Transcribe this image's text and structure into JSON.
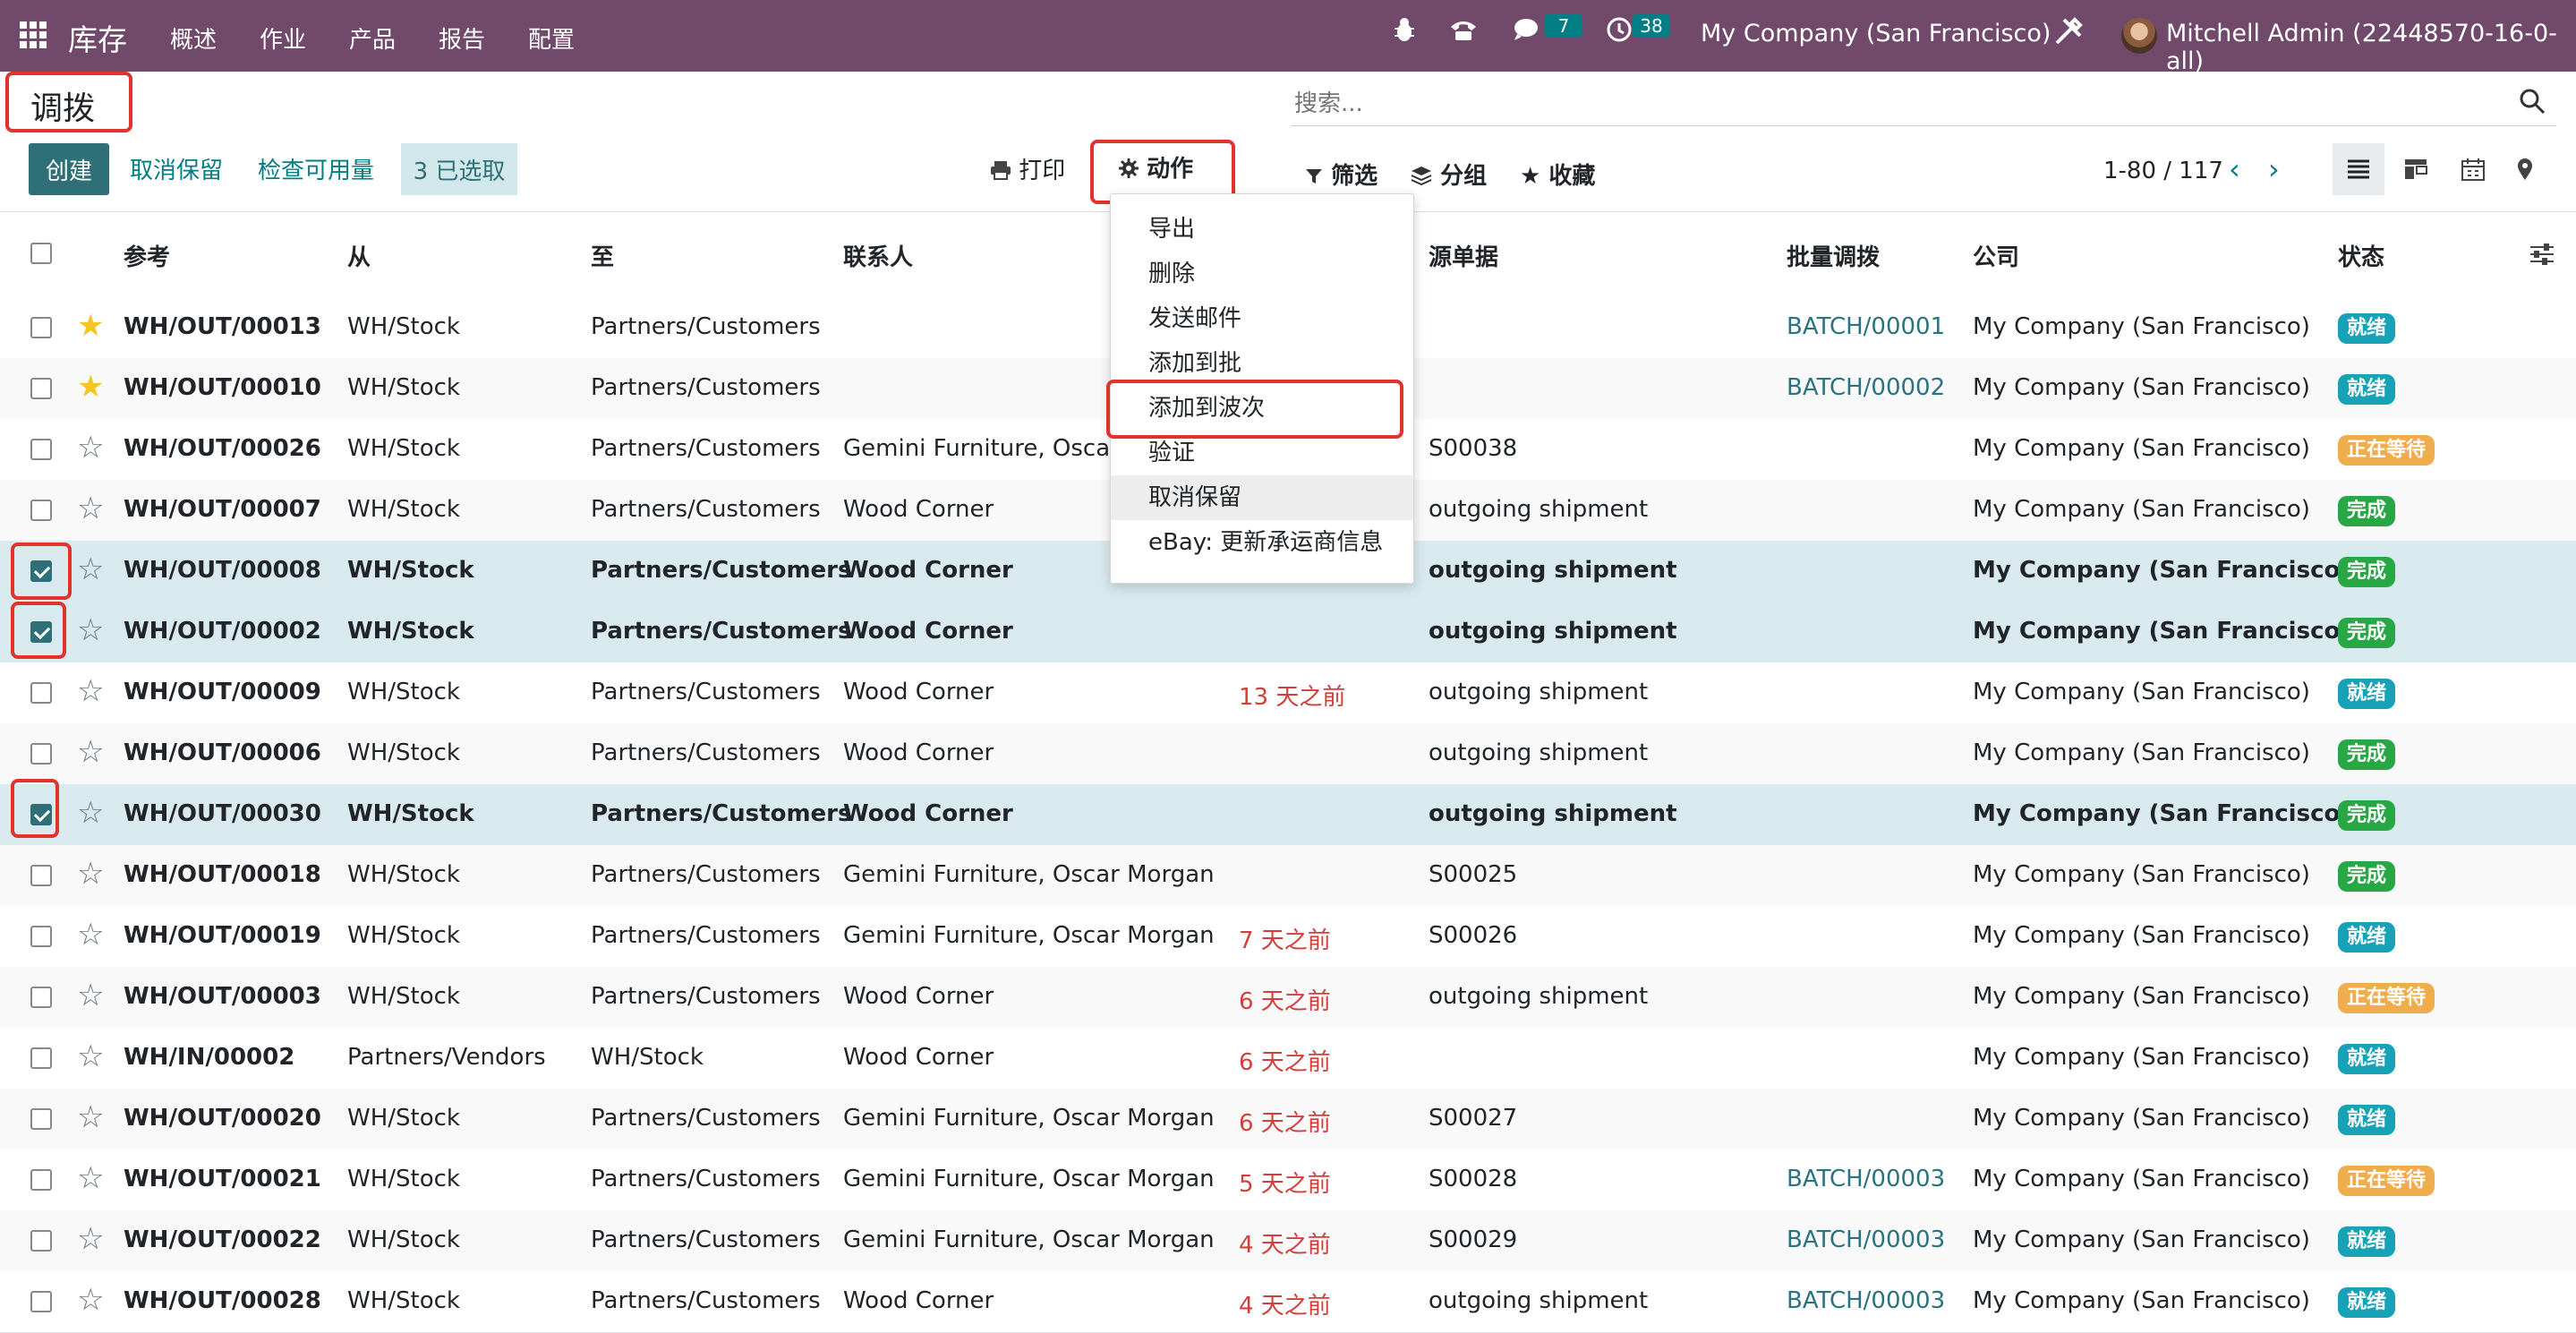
{
  "navbar": {
    "brand": "库存",
    "menus": [
      "概述",
      "作业",
      "产品",
      "报告",
      "配置"
    ],
    "chat_count": "7",
    "activity_count": "38",
    "company": "My Company (San Francisco)",
    "user": "Mitchell Admin (22448570-16-0-all)",
    "bg_color": "#71496a"
  },
  "page": {
    "title": "调拨"
  },
  "toolbar": {
    "create_label": "创建",
    "unreserve_label": "取消保留",
    "check_availability_label": "检查可用量",
    "selected_label": "3 已选取",
    "print_label": "打印",
    "action_label": "动作"
  },
  "search": {
    "placeholder": "搜索..."
  },
  "facets": {
    "filter_label": "筛选",
    "group_label": "分组",
    "favorites_label": "收藏"
  },
  "pager": {
    "range": "1-80 / 117"
  },
  "columns": [
    "参考",
    "从",
    "至",
    "联系人",
    "源单据",
    "批量调拨",
    "公司",
    "状态"
  ],
  "action_menu": {
    "items": [
      "导出",
      "删除",
      "发送邮件",
      "添加到批",
      "添加到波次",
      "验证",
      "取消保留",
      "eBay: 更新承运商信息"
    ]
  },
  "rows": [
    {
      "starred": true,
      "checked": false,
      "ref": "WH/OUT/00013",
      "from": "WH/Stock",
      "to": "Partners/Customers",
      "contact": "",
      "scheduled": "",
      "source": "",
      "batch": "BATCH/00001",
      "company": "My Company (San Francisco)",
      "status": "就绪",
      "status_kind": "ready"
    },
    {
      "starred": true,
      "checked": false,
      "ref": "WH/OUT/00010",
      "from": "WH/Stock",
      "to": "Partners/Customers",
      "contact": "",
      "scheduled": "",
      "source": "",
      "batch": "BATCH/00002",
      "company": "My Company (San Francisco)",
      "status": "就绪",
      "status_kind": "ready"
    },
    {
      "starred": false,
      "checked": false,
      "ref": "WH/OUT/00026",
      "from": "WH/Stock",
      "to": "Partners/Customers",
      "contact": "Gemini Furniture, Oscar Morgan",
      "scheduled": "",
      "source": "S00038",
      "batch": "",
      "company": "My Company (San Francisco)",
      "status": "正在等待",
      "status_kind": "wait"
    },
    {
      "starred": false,
      "checked": false,
      "ref": "WH/OUT/00007",
      "from": "WH/Stock",
      "to": "Partners/Customers",
      "contact": "Wood Corner",
      "scheduled": "",
      "source": "outgoing shipment",
      "batch": "",
      "company": "My Company (San Francisco)",
      "status": "完成",
      "status_kind": "done"
    },
    {
      "starred": false,
      "checked": true,
      "ref": "WH/OUT/00008",
      "from": "WH/Stock",
      "to": "Partners/Customers",
      "contact": "Wood Corner",
      "scheduled": "",
      "source": "outgoing shipment",
      "batch": "",
      "company": "My Company (San Francisco)",
      "status": "完成",
      "status_kind": "done"
    },
    {
      "starred": false,
      "checked": true,
      "ref": "WH/OUT/00002",
      "from": "WH/Stock",
      "to": "Partners/Customers",
      "contact": "Wood Corner",
      "scheduled": "",
      "source": "outgoing shipment",
      "batch": "",
      "company": "My Company (San Francisco)",
      "status": "完成",
      "status_kind": "done"
    },
    {
      "starred": false,
      "checked": false,
      "ref": "WH/OUT/00009",
      "from": "WH/Stock",
      "to": "Partners/Customers",
      "contact": "Wood Corner",
      "scheduled": "13 天之前",
      "source": "outgoing shipment",
      "batch": "",
      "company": "My Company (San Francisco)",
      "status": "就绪",
      "status_kind": "ready"
    },
    {
      "starred": false,
      "checked": false,
      "ref": "WH/OUT/00006",
      "from": "WH/Stock",
      "to": "Partners/Customers",
      "contact": "Wood Corner",
      "scheduled": "",
      "source": "outgoing shipment",
      "batch": "",
      "company": "My Company (San Francisco)",
      "status": "完成",
      "status_kind": "done"
    },
    {
      "starred": false,
      "checked": true,
      "ref": "WH/OUT/00030",
      "from": "WH/Stock",
      "to": "Partners/Customers",
      "contact": "Wood Corner",
      "scheduled": "",
      "source": "outgoing shipment",
      "batch": "",
      "company": "My Company (San Francisco)",
      "status": "完成",
      "status_kind": "done"
    },
    {
      "starred": false,
      "checked": false,
      "ref": "WH/OUT/00018",
      "from": "WH/Stock",
      "to": "Partners/Customers",
      "contact": "Gemini Furniture, Oscar Morgan",
      "scheduled": "",
      "source": "S00025",
      "batch": "",
      "company": "My Company (San Francisco)",
      "status": "完成",
      "status_kind": "done"
    },
    {
      "starred": false,
      "checked": false,
      "ref": "WH/OUT/00019",
      "from": "WH/Stock",
      "to": "Partners/Customers",
      "contact": "Gemini Furniture, Oscar Morgan",
      "scheduled": "7 天之前",
      "source": "S00026",
      "batch": "",
      "company": "My Company (San Francisco)",
      "status": "就绪",
      "status_kind": "ready"
    },
    {
      "starred": false,
      "checked": false,
      "ref": "WH/OUT/00003",
      "from": "WH/Stock",
      "to": "Partners/Customers",
      "contact": "Wood Corner",
      "scheduled": "6 天之前",
      "source": "outgoing shipment",
      "batch": "",
      "company": "My Company (San Francisco)",
      "status": "正在等待",
      "status_kind": "wait"
    },
    {
      "starred": false,
      "checked": false,
      "ref": "WH/IN/00002",
      "from": "Partners/Vendors",
      "to": "WH/Stock",
      "contact": "Wood Corner",
      "scheduled": "6 天之前",
      "source": "",
      "batch": "",
      "company": "My Company (San Francisco)",
      "status": "就绪",
      "status_kind": "ready"
    },
    {
      "starred": false,
      "checked": false,
      "ref": "WH/OUT/00020",
      "from": "WH/Stock",
      "to": "Partners/Customers",
      "contact": "Gemini Furniture, Oscar Morgan",
      "scheduled": "6 天之前",
      "source": "S00027",
      "batch": "",
      "company": "My Company (San Francisco)",
      "status": "就绪",
      "status_kind": "ready"
    },
    {
      "starred": false,
      "checked": false,
      "ref": "WH/OUT/00021",
      "from": "WH/Stock",
      "to": "Partners/Customers",
      "contact": "Gemini Furniture, Oscar Morgan",
      "scheduled": "5 天之前",
      "source": "S00028",
      "batch": "BATCH/00003",
      "company": "My Company (San Francisco)",
      "status": "正在等待",
      "status_kind": "wait"
    },
    {
      "starred": false,
      "checked": false,
      "ref": "WH/OUT/00022",
      "from": "WH/Stock",
      "to": "Partners/Customers",
      "contact": "Gemini Furniture, Oscar Morgan",
      "scheduled": "4 天之前",
      "source": "S00029",
      "batch": "BATCH/00003",
      "company": "My Company (San Francisco)",
      "status": "就绪",
      "status_kind": "ready"
    },
    {
      "starred": false,
      "checked": false,
      "ref": "WH/OUT/00028",
      "from": "WH/Stock",
      "to": "Partners/Customers",
      "contact": "Wood Corner",
      "scheduled": "4 天之前",
      "source": "outgoing shipment",
      "batch": "BATCH/00003",
      "company": "My Company (San Francisco)",
      "status": "就绪",
      "status_kind": "ready"
    }
  ],
  "colors": {
    "accent": "#017e84",
    "highlight_box": "#e0332e",
    "ready": "#17a2b8",
    "waiting": "#f0ad4e",
    "done": "#28a745"
  }
}
